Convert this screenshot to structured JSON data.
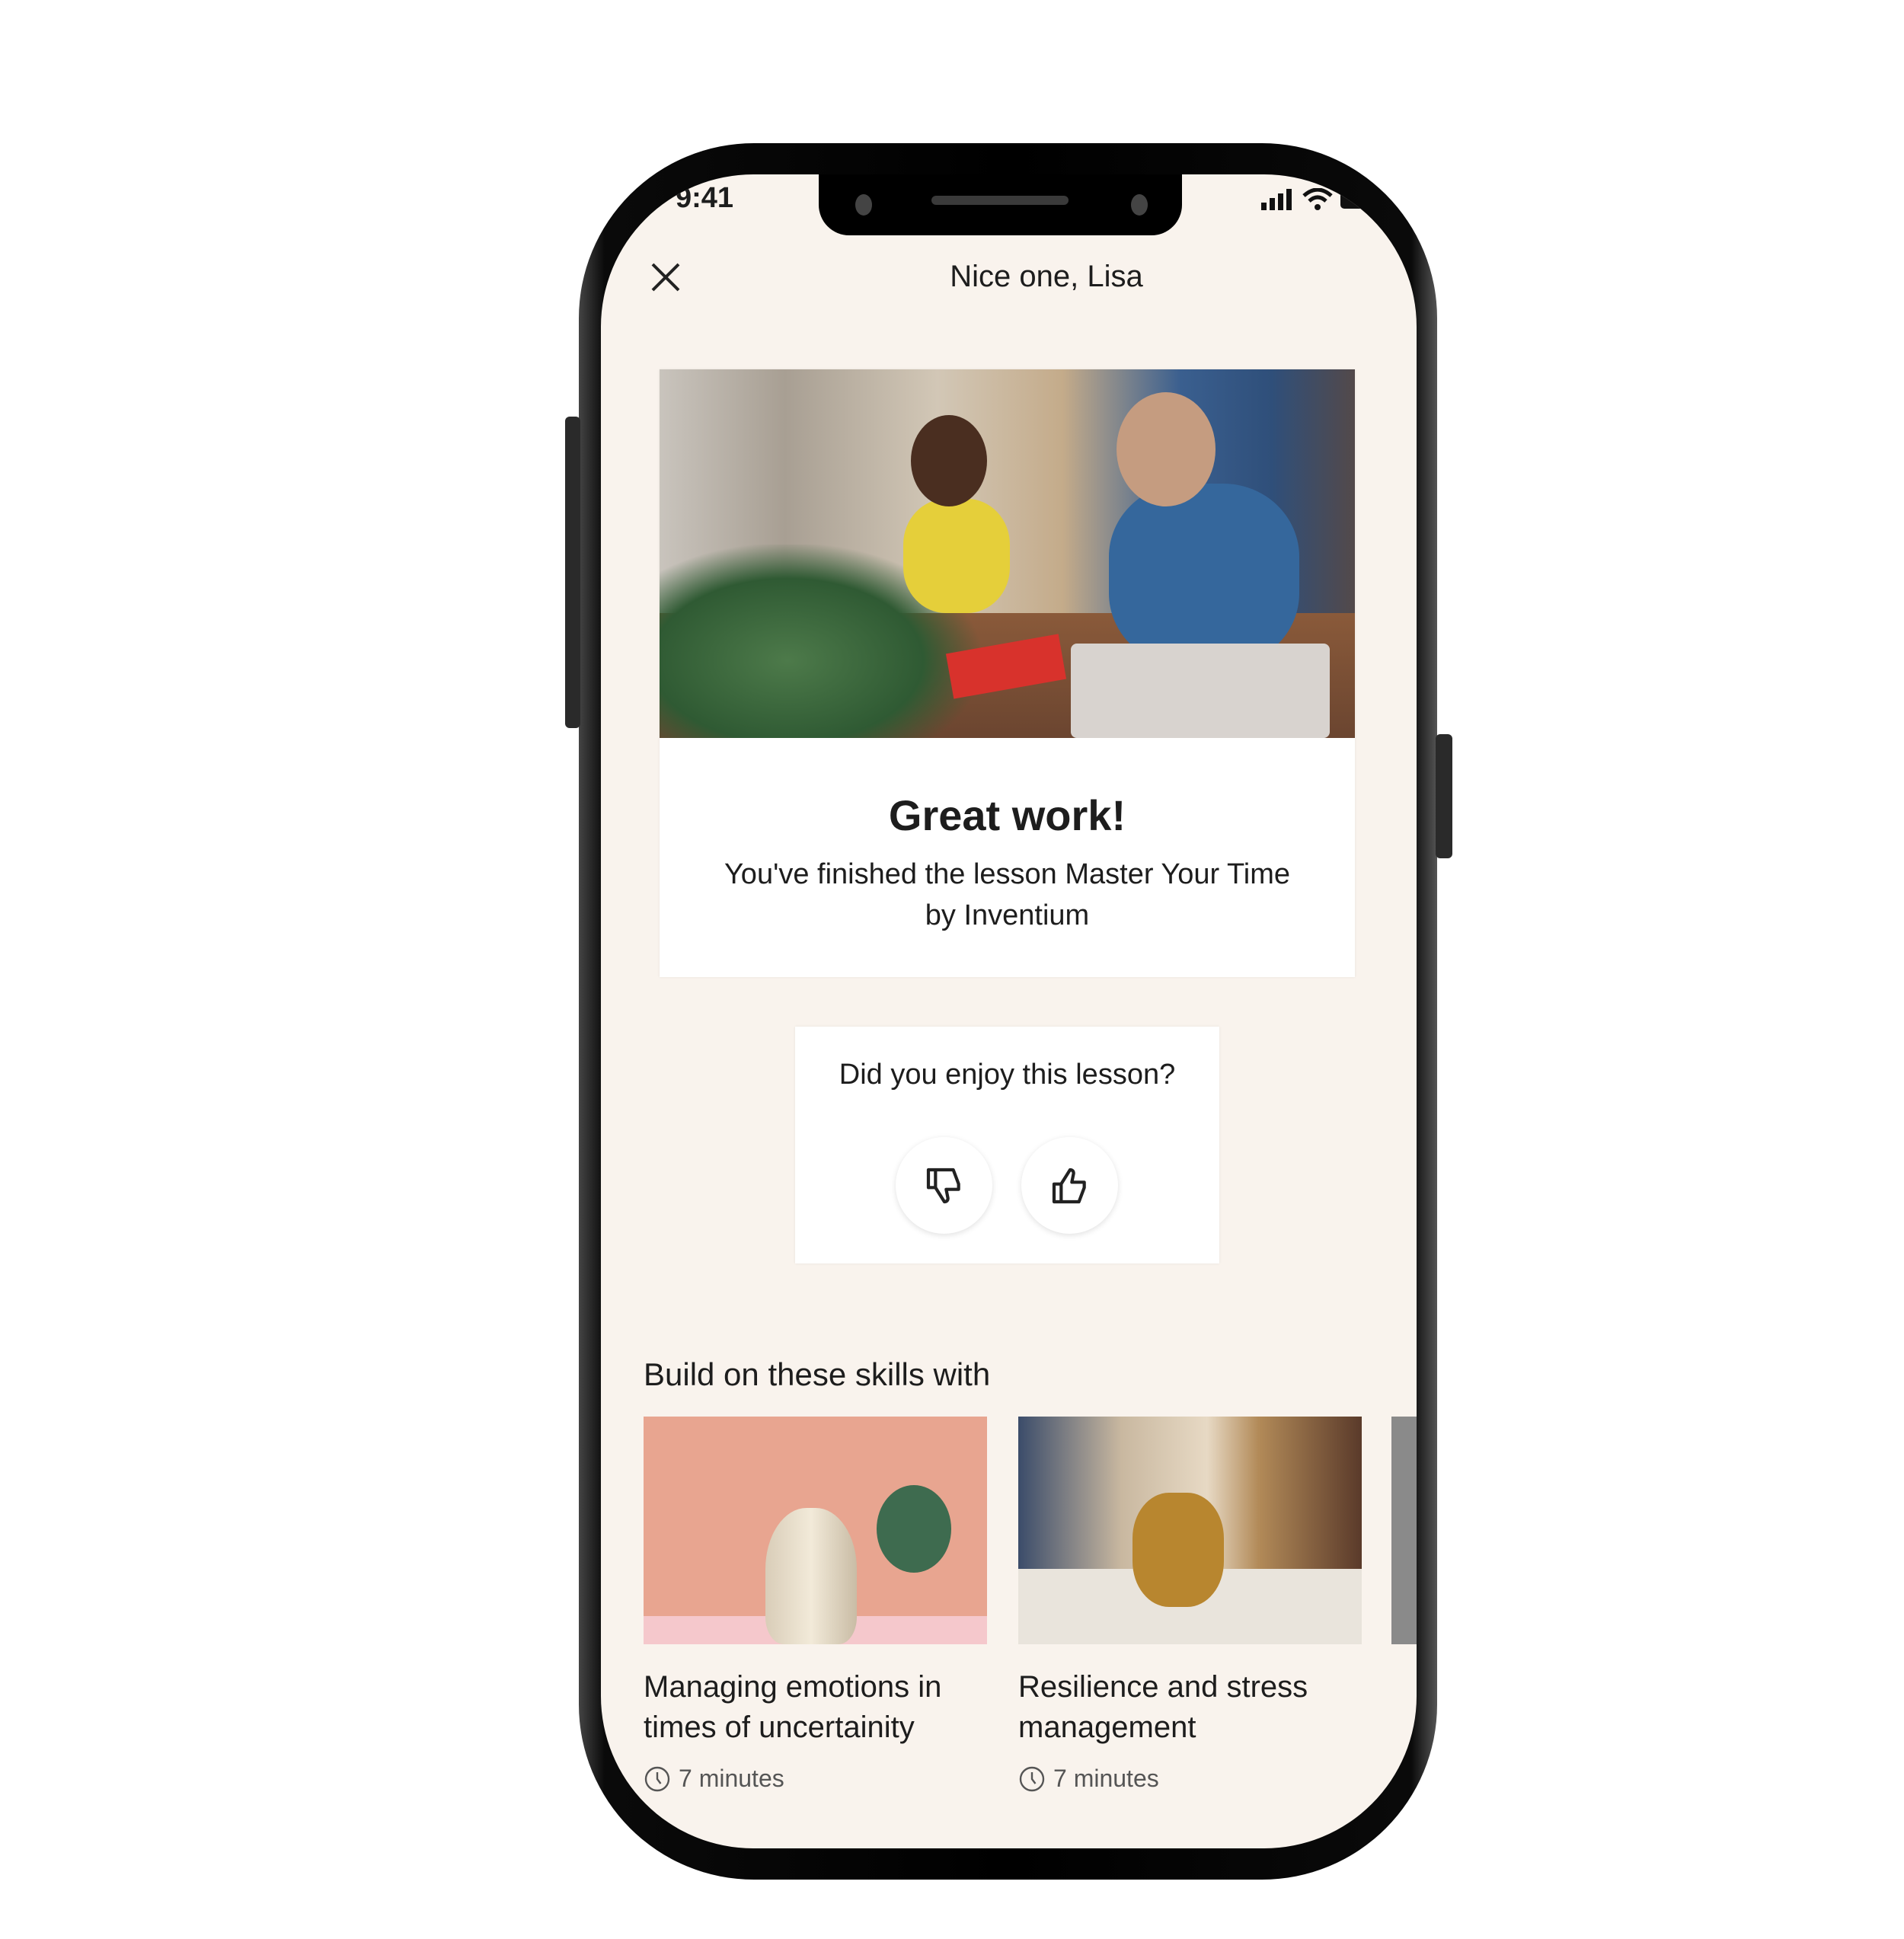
{
  "status_bar": {
    "time": "9:41",
    "icons": [
      "signal-icon",
      "wifi-icon",
      "battery-icon"
    ]
  },
  "header": {
    "title": "Nice one, Lisa",
    "close_icon": "close-icon"
  },
  "completion": {
    "heading": "Great work!",
    "message": "You've finished the lesson Master Your Time by Inventium"
  },
  "feedback": {
    "question": "Did you enjoy this lesson?",
    "buttons": [
      "thumbs-down-icon",
      "thumbs-up-icon"
    ]
  },
  "recommendations": {
    "heading": "Build on these skills with",
    "items": [
      {
        "title": "Managing emotions in times of uncertainity",
        "duration": "7 minutes"
      },
      {
        "title": "Resilience and stress management",
        "duration": "7 minutes"
      }
    ]
  },
  "colors": {
    "background": "#f9f3ed",
    "card": "#ffffff",
    "accent_green": "#3e6b4f",
    "thumb_pink": "#e8a590"
  }
}
